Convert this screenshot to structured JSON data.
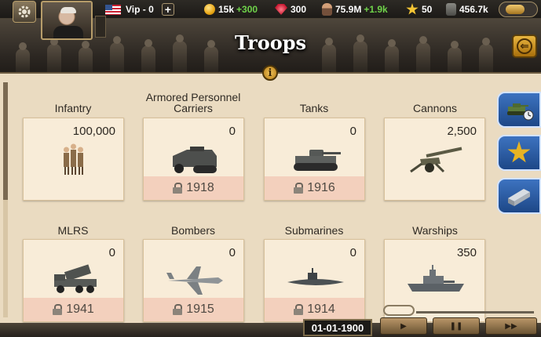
{
  "header": {
    "vip_label": "Vip - 0",
    "vip_plus": "+",
    "gold": "15k",
    "gold_gain": "+300",
    "gems": "300",
    "population": "75.9M",
    "population_gain": "+1.9k",
    "stars": "50",
    "money": "456.7k"
  },
  "banner": {
    "title": "Troops",
    "info": "i"
  },
  "categories": [
    {
      "name": "Infantry",
      "count": "100,000",
      "unlock": ""
    },
    {
      "name": "Armored Personnel Carriers",
      "count": "0",
      "unlock": "1918"
    },
    {
      "name": "Tanks",
      "count": "0",
      "unlock": "1916"
    },
    {
      "name": "Cannons",
      "count": "2,500",
      "unlock": ""
    },
    {
      "name": "MLRS",
      "count": "0",
      "unlock": "1941"
    },
    {
      "name": "Bombers",
      "count": "0",
      "unlock": "1915"
    },
    {
      "name": "Submarines",
      "count": "0",
      "unlock": "1914"
    },
    {
      "name": "Warships",
      "count": "350",
      "unlock": ""
    }
  ],
  "footer": {
    "date": "01-01-1900",
    "play": "▶",
    "pause": "❚❚",
    "fast": "▶▶"
  },
  "icons": {
    "settings": "gear-icon",
    "back": "back-arrow-icon",
    "info": "info-icon",
    "tab1": "tank-clock-icon",
    "tab2": "star-icon",
    "tab3": "steel-beam-icon"
  }
}
